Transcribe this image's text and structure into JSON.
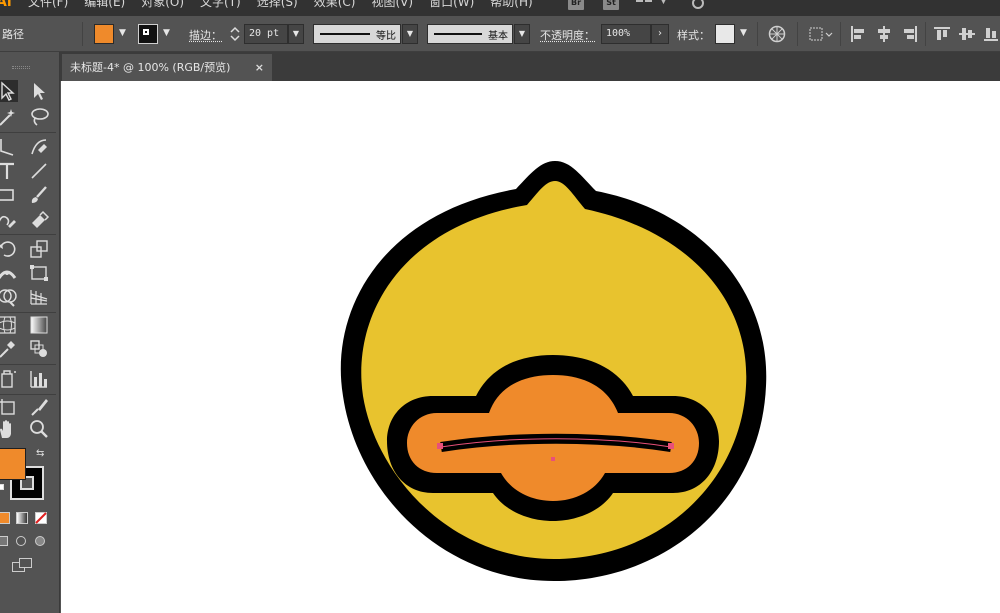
{
  "app": {
    "logo": "Ai"
  },
  "menu": {
    "items": [
      "文件(F)",
      "编辑(E)",
      "对象(O)",
      "文字(T)",
      "选择(S)",
      "效果(C)",
      "视图(V)",
      "窗口(W)",
      "帮助(H)"
    ],
    "badges": [
      "Br",
      "St"
    ]
  },
  "control_bar": {
    "selection_label": "路径",
    "fill_color": "#ef8a2b",
    "stroke_label": "描边：",
    "stroke_weight": "20 pt",
    "stroke_profile_label": "等比",
    "brush_label": "基本",
    "opacity_label": "不透明度：",
    "opacity_value": "100%",
    "style_label": "样式："
  },
  "document": {
    "tab_title": "未标题-4* @ 100% (RGB/预览)",
    "close_glyph": "×"
  },
  "colors": {
    "duck_yellow": "#e8c32e",
    "beak_orange": "#ef8a2b",
    "outline": "#000000",
    "selection_path": "#e8507a"
  },
  "tools": [
    "selection-tool",
    "direct-selection-tool",
    "magic-wand-tool",
    "lasso-tool",
    "pen-tool",
    "curvature-tool",
    "type-tool",
    "line-segment-tool",
    "rectangle-tool",
    "paintbrush-tool",
    "shaper-tool",
    "eraser-tool",
    "rotate-tool",
    "scale-tool",
    "width-tool",
    "free-transform-tool",
    "shape-builder-tool",
    "perspective-grid-tool",
    "mesh-tool",
    "gradient-tool",
    "eyedropper-tool",
    "blend-tool",
    "symbol-sprayer-tool",
    "column-graph-tool",
    "artboard-tool",
    "slice-tool",
    "hand-tool",
    "zoom-tool"
  ]
}
